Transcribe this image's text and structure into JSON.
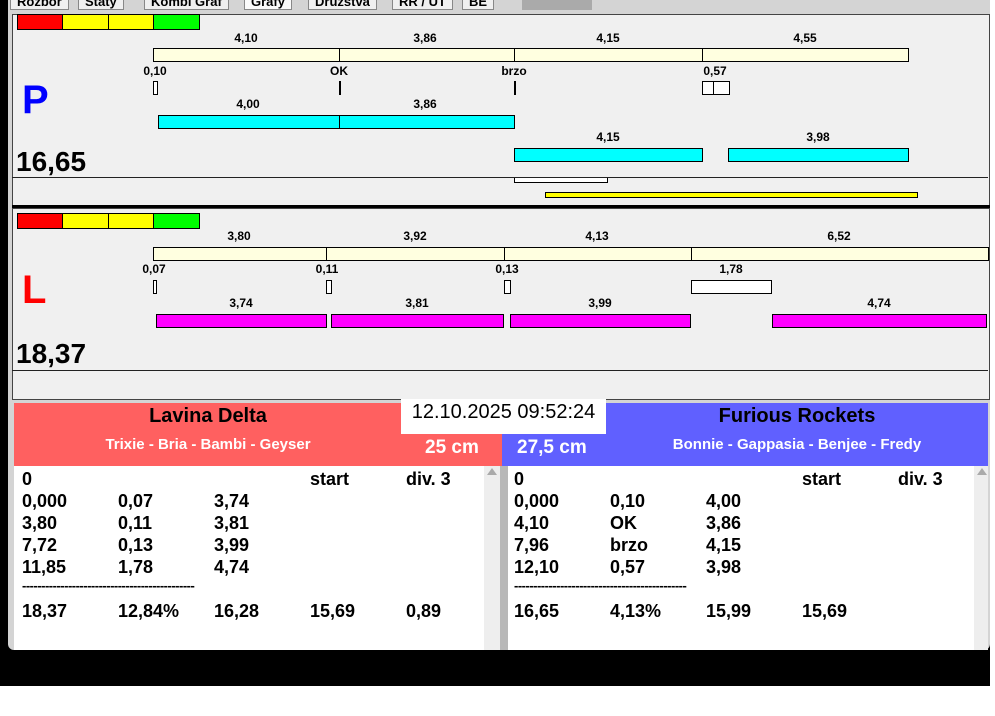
{
  "tabs": [
    "Rozbor",
    "Staty",
    "Kombi Graf",
    "Grafy",
    "Družstva",
    "RR / UT",
    "BE"
  ],
  "colors": {
    "red": "#ff0000",
    "yellow": "#ffff00",
    "green": "#00ff00",
    "cream": "#ffffe0",
    "cyan": "#00ffff",
    "magenta": "#ff00ff",
    "team_left": "#ff6060",
    "team_right": "#6060ff"
  },
  "panel_p": {
    "letter": "P",
    "score": "16,65",
    "top_bar_labels": [
      "4,10",
      "3,86",
      "4,15",
      "4,55"
    ],
    "reaction_labels": [
      "0,10",
      "OK",
      "brzo",
      "0,57"
    ],
    "run_bar_labels_1": [
      "4,00",
      "3,86"
    ],
    "run_bar_labels_2": [
      "4,15",
      "3,98"
    ]
  },
  "panel_l": {
    "letter": "L",
    "score": "18,37",
    "top_bar_labels": [
      "3,80",
      "3,92",
      "4,13",
      "6,52"
    ],
    "reaction_labels": [
      "0,07",
      "0,11",
      "0,13",
      "1,78"
    ],
    "run_bar_labels": [
      "3,74",
      "3,81",
      "3,99",
      "4,74"
    ]
  },
  "datetime": "12.10.2025 09:52:24",
  "left_team": {
    "name": "Lavina Delta",
    "members": "Trixie - Bria - Bambi - Geyser",
    "distance": "25 cm",
    "header": [
      "0",
      "",
      "",
      "start",
      "div.  3"
    ],
    "rows": [
      [
        "0,000",
        "0,07",
        "3,74"
      ],
      [
        "3,80",
        "0,11",
        "3,81"
      ],
      [
        "7,72",
        "0,13",
        "3,99"
      ],
      [
        "11,85",
        "1,78",
        "4,74"
      ]
    ],
    "separator": "---------------------------------------------",
    "totals": [
      "18,37",
      "12,84%",
      "16,28",
      "15,69",
      "0,89"
    ]
  },
  "right_team": {
    "name": "Furious Rockets",
    "members": "Bonnie - Gappasia - Benjee - Fredy",
    "distance": "27,5 cm",
    "header": [
      "0",
      "",
      "",
      "start",
      "div.  3"
    ],
    "rows": [
      [
        "0,000",
        "0,10",
        "4,00"
      ],
      [
        "4,10",
        "OK",
        "3,86"
      ],
      [
        "7,96",
        "brzo",
        "4,15"
      ],
      [
        "12,10",
        "0,57",
        "3,98"
      ]
    ],
    "separator": "---------------------------------------------",
    "totals": [
      "16,65",
      "4,13%",
      "15,99",
      "15,69",
      ""
    ]
  }
}
